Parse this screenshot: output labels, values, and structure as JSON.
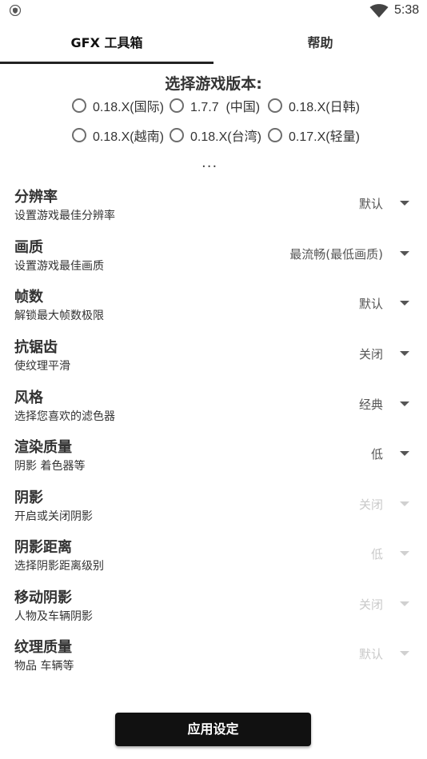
{
  "status_bar": {
    "time": "5:38"
  },
  "tabs": [
    {
      "label": "GFX 工具箱"
    },
    {
      "label": "帮助"
    }
  ],
  "version_select": {
    "title": "选择游戏版本:",
    "options": [
      {
        "label": "0.18.X(国际)"
      },
      {
        "label": "1.7.7  (中国)"
      },
      {
        "label": "0.18.X(日韩)"
      },
      {
        "label": "0.18.X(越南)"
      },
      {
        "label": "0.18.X(台湾)"
      },
      {
        "label": "0.17.X(轻量)"
      }
    ],
    "more": "..."
  },
  "settings": [
    {
      "title": "分辨率",
      "subtitle": "设置游戏最佳分辨率",
      "value": "默认"
    },
    {
      "title": "画质",
      "subtitle": "设置游戏最佳画质",
      "value": "最流畅(最低画质)"
    },
    {
      "title": "帧数",
      "subtitle": "解锁最大帧数极限",
      "value": "默认"
    },
    {
      "title": "抗锯齿",
      "subtitle": "使纹理平滑",
      "value": "关闭"
    },
    {
      "title": "风格",
      "subtitle": "选择您喜欢的滤色器",
      "value": "经典"
    },
    {
      "title": "渲染质量",
      "subtitle": "阴影 着色器等",
      "value": "低"
    },
    {
      "title": "阴影",
      "subtitle": "开启或关闭阴影",
      "value": "关闭"
    },
    {
      "title": "阴影距离",
      "subtitle": "选择阴影距离级别",
      "value": "低"
    },
    {
      "title": "移动阴影",
      "subtitle": "人物及车辆阴影",
      "value": "关闭"
    },
    {
      "title": "纹理质量",
      "subtitle": "物品 车辆等",
      "value": "默认"
    }
  ],
  "apply_button": {
    "label": "应用设定"
  }
}
